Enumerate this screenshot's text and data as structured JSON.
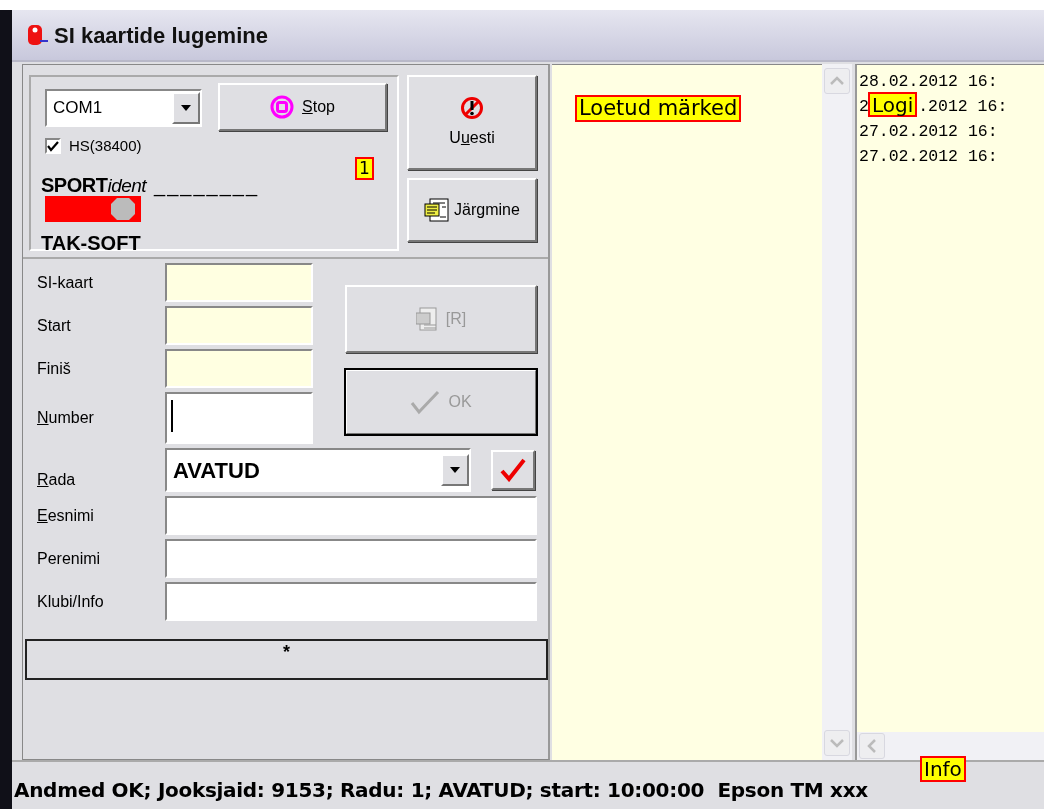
{
  "window": {
    "title": "SI kaartide lugemine"
  },
  "reader": {
    "port": "COM1",
    "hs": {
      "label": "HS(38400)",
      "checked": true
    },
    "stop_button": {
      "label": {
        "key": "S",
        "after": "top"
      }
    },
    "callout": "1",
    "logo": {
      "brand": "SPORT",
      "brand_suffix": "ident",
      "blank": "________",
      "maker": "TAK-SOFT"
    }
  },
  "side_buttons": [
    {
      "label": {
        "before": "U",
        "key": "u",
        "after": "esti"
      },
      "kind": "restart"
    },
    {
      "label": "Järgmine",
      "kind": "next"
    }
  ],
  "card_fields": [
    {
      "label": "SI-kaart",
      "kind": "readonly"
    },
    {
      "label": "Start",
      "kind": "readonly"
    },
    {
      "label": "Finiš",
      "kind": "readonly"
    },
    {
      "label": {
        "key": "N",
        "after": "umber"
      },
      "kind": "input",
      "focused": true
    }
  ],
  "action_buttons": [
    {
      "label": "[R]",
      "kind": "print",
      "disabled": true,
      "default": false
    },
    {
      "label": "OK",
      "kind": "ok",
      "disabled": true,
      "default": true
    }
  ],
  "runner_fields": [
    {
      "label": {
        "key": "R",
        "after": "ada"
      },
      "kind": "combo",
      "value": "AVATUD"
    },
    {
      "label": {
        "key": "E",
        "after": "esnimi"
      },
      "kind": "input"
    },
    {
      "label": "Perenimi",
      "kind": "input"
    },
    {
      "label": "Klubi/Info",
      "kind": "input"
    }
  ],
  "star_bar": "*",
  "marks_pane": {
    "callout": "Loetud märked"
  },
  "log": {
    "callout": "Logi",
    "lines": [
      {
        "text": "28.02.2012 16:"
      },
      {
        "before": "2",
        "after": ".2012 16:"
      },
      {
        "text": "27.02.2012 16:"
      },
      {
        "text": "27.02.2012 16:"
      }
    ]
  },
  "status_bar": {
    "text": "Andmed OK; Jooksjaid: 9153; Radu: 1; AVATUD; start: 10:00:00  Epson TM xxx",
    "callout": "Info"
  }
}
